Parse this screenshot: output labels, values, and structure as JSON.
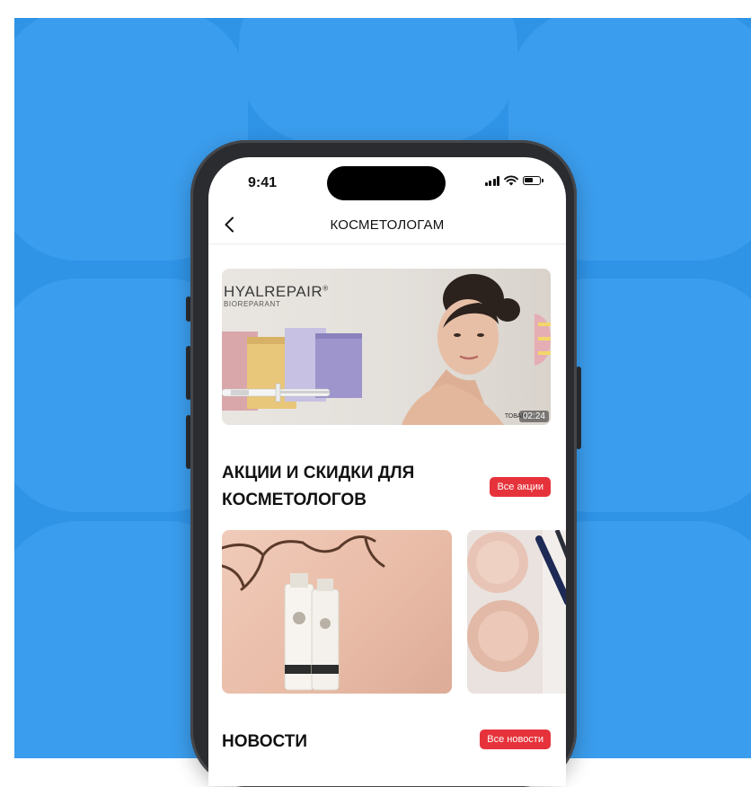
{
  "status_bar": {
    "time": "9:41"
  },
  "nav": {
    "title": "КОСМЕТОЛОГАМ"
  },
  "banner": {
    "brand": "HYALREPAIR",
    "brand_mark": "®",
    "subtitle": "BIOREPARANT",
    "tag": "ТОВАР",
    "video_time": "02:24"
  },
  "promotions": {
    "title_line1": "АКЦИИ И СКИДКИ ДЛЯ",
    "title_line2": "КОСМЕТОЛОГОВ",
    "all_label": "Все акции"
  },
  "news": {
    "title": "НОВОСТИ",
    "all_label": "Все новости"
  },
  "colors": {
    "background": "#2f93e6",
    "accent": "#e6333b",
    "phone_frame": "#2a2c30"
  }
}
